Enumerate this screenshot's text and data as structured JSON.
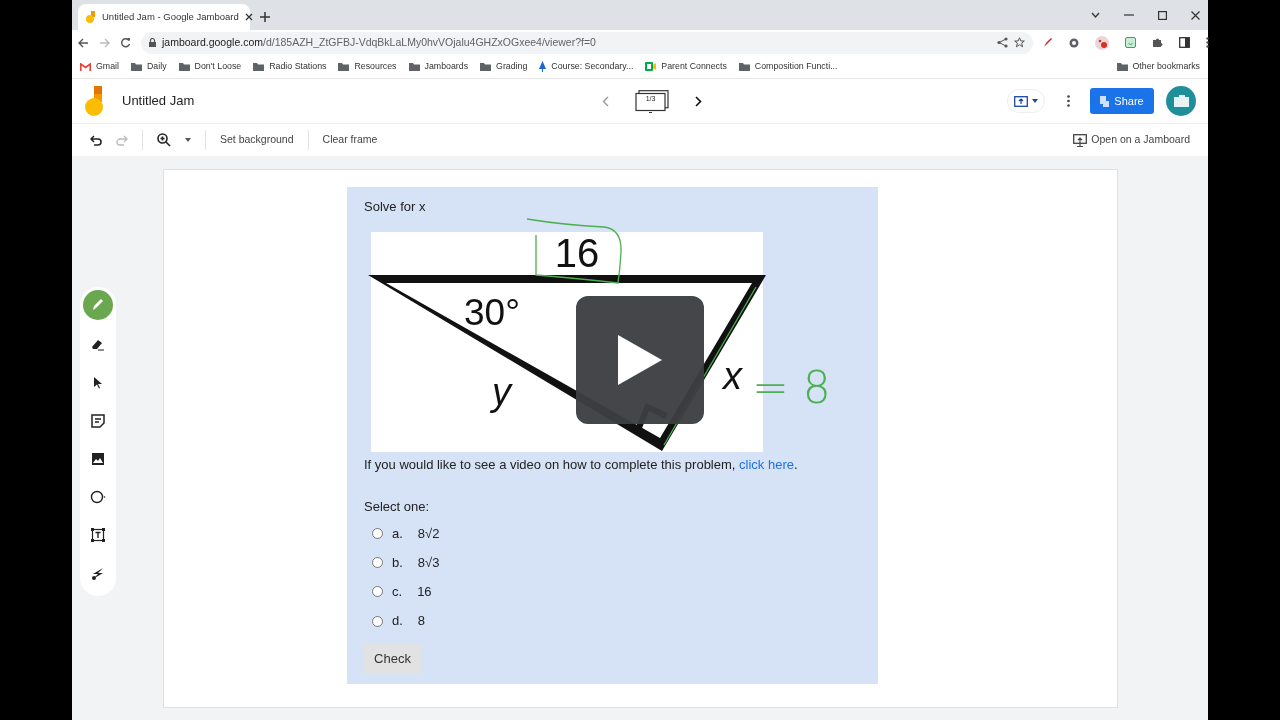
{
  "browser": {
    "tab_title": "Untitled Jam - Google Jamboard",
    "url_host": "jamboard.google.com",
    "url_path": "/d/185AZH_ZtGFBJ-VdqBkLaLMy0hvVOjalu4GHZxOGxee4/viewer?f=0",
    "bookmarks": [
      {
        "kind": "gmail",
        "label": "Gmail"
      },
      {
        "kind": "folder",
        "label": "Daily"
      },
      {
        "kind": "folder",
        "label": "Don't Loose"
      },
      {
        "kind": "folder",
        "label": "Radio Stations"
      },
      {
        "kind": "folder",
        "label": "Resources"
      },
      {
        "kind": "folder",
        "label": "Jamboards"
      },
      {
        "kind": "folder",
        "label": "Grading"
      },
      {
        "kind": "course",
        "label": "Course: Secondary..."
      },
      {
        "kind": "meet",
        "label": "Parent Connects"
      },
      {
        "kind": "folder",
        "label": "Composition Functi..."
      }
    ],
    "other_bookmarks": "Other bookmarks"
  },
  "jam": {
    "title": "Untitled Jam",
    "frame_counter": "1/3",
    "share": "Share",
    "set_background": "Set background",
    "clear_frame": "Clear frame",
    "open_on_jamboard": "Open on a Jamboard",
    "redo_disabled": true
  },
  "tools": [
    {
      "kind": "pen",
      "selected": true
    },
    {
      "kind": "eraser",
      "selected": false
    },
    {
      "kind": "select",
      "selected": false
    },
    {
      "kind": "note",
      "selected": false
    },
    {
      "kind": "image",
      "selected": false
    },
    {
      "kind": "circle",
      "selected": false
    },
    {
      "kind": "textbox",
      "selected": false
    },
    {
      "kind": "laser",
      "selected": false
    }
  ],
  "question": {
    "prompt": "Solve for x",
    "figure": {
      "top_side": "16",
      "angle": "30°",
      "left_side": "y",
      "right_side": "x",
      "annotation": "= 8"
    },
    "video_text": "If you would like to see a video on how to complete this problem, ",
    "video_link": "click here",
    "video_end": ".",
    "select_label": "Select one:",
    "options": [
      {
        "letter": "a.",
        "text": "8√2",
        "selected": false
      },
      {
        "letter": "b.",
        "text": "8√3",
        "selected": false
      },
      {
        "letter": "c.",
        "text": "16",
        "selected": false
      },
      {
        "letter": "d.",
        "text": "8",
        "selected": false
      }
    ],
    "check": "Check"
  }
}
